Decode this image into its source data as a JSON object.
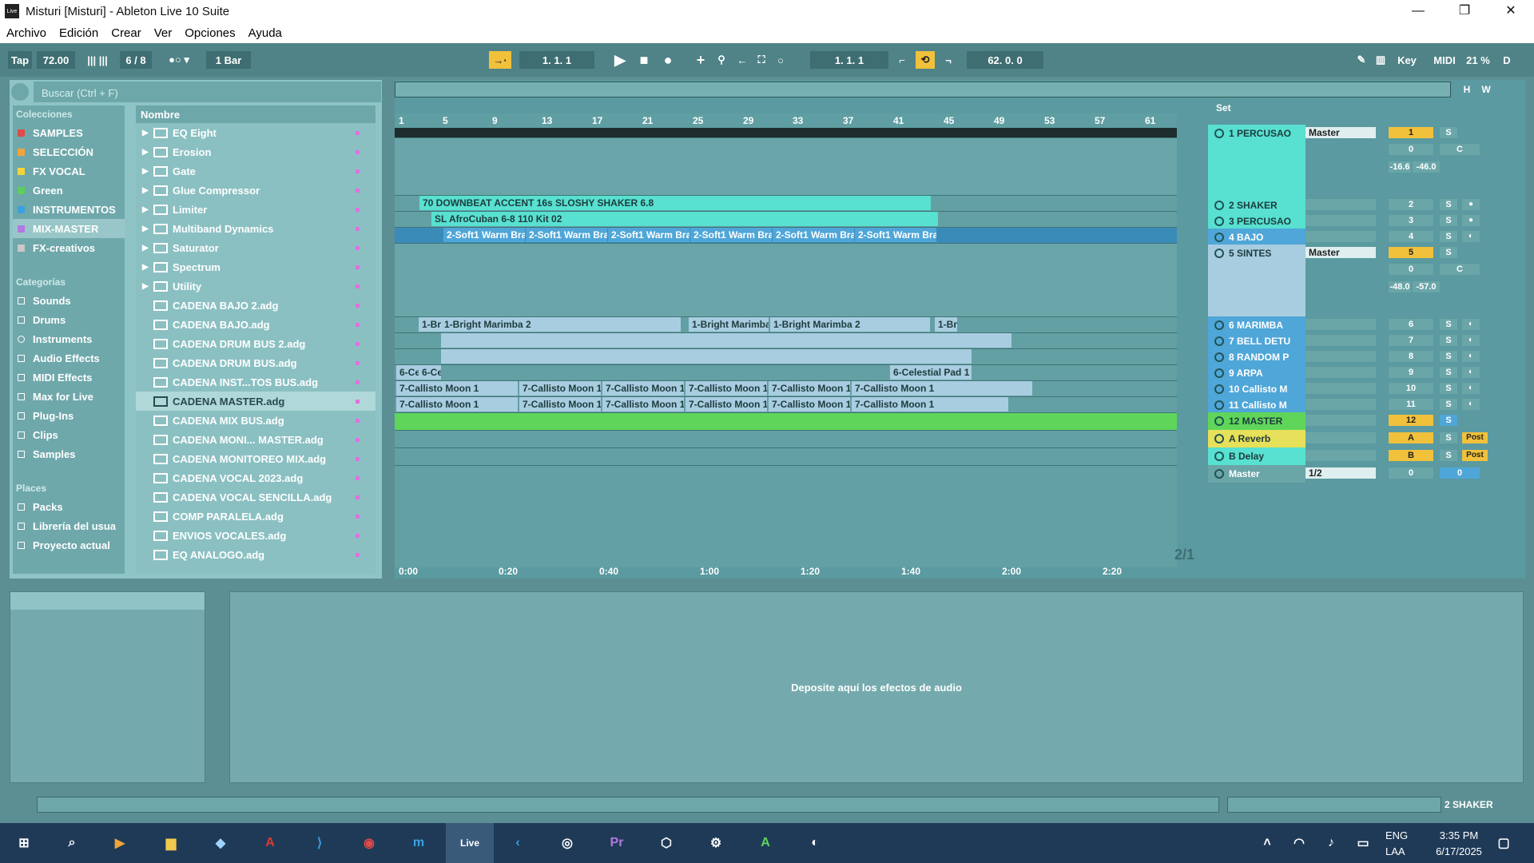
{
  "window": {
    "title": "Misturi  [Misturi] - Ableton Live 10 Suite",
    "app_icon": "Live"
  },
  "menu": [
    "Archivo",
    "Edición",
    "Crear",
    "Ver",
    "Opciones",
    "Ayuda"
  ],
  "control_bar": {
    "tap": "Tap",
    "tempo": "72.00",
    "signature": "6 / 8",
    "quantize": "1 Bar",
    "position": "1.   1.   1",
    "loop_start": "1.   1.   1",
    "loop_length": "62.   0.   0",
    "key": "Key",
    "midi": "MIDI",
    "cpu": "21 %",
    "d": "D"
  },
  "browser": {
    "search_placeholder": "Buscar (Ctrl + F)",
    "collections_header": "Colecciones",
    "collections": [
      {
        "label": "SAMPLES",
        "color": "#e04a4a"
      },
      {
        "label": "SELECCIÓN",
        "color": "#f0a43a"
      },
      {
        "label": "FX VOCAL",
        "color": "#f2d43a"
      },
      {
        "label": "Green",
        "color": "#5ccf5c"
      },
      {
        "label": "INSTRUMENTOS",
        "color": "#3aa0e0"
      },
      {
        "label": "MIX-MASTER",
        "color": "#b07ae0"
      },
      {
        "label": "FX-creativos",
        "color": "#c8c8c8"
      }
    ],
    "categories_header": "Categorías",
    "categories": [
      "Sounds",
      "Drums",
      "Instruments",
      "Audio Effects",
      "MIDI Effects",
      "Max for Live",
      "Plug-Ins",
      "Clips",
      "Samples"
    ],
    "places_header": "Places",
    "places": [
      "Packs",
      "Librería del usua",
      "Proyecto actual"
    ],
    "names_header": "Nombre",
    "folders": [
      "EQ Eight",
      "Erosion",
      "Gate",
      "Glue Compressor",
      "Limiter",
      "Multiband Dynamics",
      "Saturator",
      "Spectrum",
      "Utility"
    ],
    "files": [
      "CADENA BAJO 2.adg",
      "CADENA BAJO.adg",
      "CADENA DRUM BUS 2.adg",
      "CADENA DRUM BUS.adg",
      "CADENA INST...TOS BUS.adg",
      "CADENA MASTER.adg",
      "CADENA MIX BUS.adg",
      "CADENA MONI... MASTER.adg",
      "CADENA MONITOREO MIX.adg",
      "CADENA VOCAL 2023.adg",
      "CADENA VOCAL SENCILLA.adg",
      "COMP PARALELA.adg",
      "ENVIOS VOCALES.adg",
      "EQ ANALOGO.adg"
    ]
  },
  "ruler": [
    "1",
    "5",
    "9",
    "13",
    "17",
    "21",
    "25",
    "29",
    "33",
    "37",
    "41",
    "45",
    "49",
    "53",
    "57",
    "61"
  ],
  "time_ruler": [
    "0:00",
    "0:20",
    "0:40",
    "1:00",
    "1:20",
    "1:40",
    "2:00",
    "2:20"
  ],
  "clips": {
    "shaker": "70 DOWNBEAT ACCENT 16s SLOSHY SHAKER 6.8",
    "percu": "SL  AfroCuban  6-8  110  Kit  02",
    "brass": "2-Soft1 Warm Brass",
    "marimba": "1-Bright Marimba 2",
    "marimba_short": "1-Br",
    "celestial": "6-Celestial Pad 1",
    "celestial_short": "6-Ce",
    "callisto": "7-Callisto Moon 1"
  },
  "set_label": "Set",
  "page_indicator": "2/1",
  "tracks": [
    {
      "name": "1 PERCUSAO",
      "num": "1",
      "routing": "Master",
      "vol": "0",
      "pan": "C",
      "peak1": "-16.6",
      "peak2": "-46.0"
    },
    {
      "name": "2 SHAKER",
      "num": "2"
    },
    {
      "name": "3 PERCUSAO",
      "num": "3"
    },
    {
      "name": "4 BAJO",
      "num": "4"
    },
    {
      "name": "5 SINTES",
      "num": "5",
      "routing": "Master",
      "vol": "0",
      "pan": "C",
      "peak1": "-48.0",
      "peak2": "-57.0"
    },
    {
      "name": "6 MARIMBA",
      "num": "6"
    },
    {
      "name": "7 BELL DETU",
      "num": "7"
    },
    {
      "name": "8 RANDOM P",
      "num": "8"
    },
    {
      "name": "9 ARPA",
      "num": "9"
    },
    {
      "name": "10 Callisto M",
      "num": "10"
    },
    {
      "name": "11 Callisto M",
      "num": "11"
    },
    {
      "name": "12 MASTER",
      "num": "12"
    },
    {
      "name": "A Reverb",
      "num": "A",
      "post": "Post"
    },
    {
      "name": "B Delay",
      "num": "B",
      "post": "Post"
    },
    {
      "name": "Master",
      "num": "0",
      "routing": "1/2",
      "vol": "0"
    }
  ],
  "solo_label": "S",
  "detail": {
    "drop_text": "Deposite aquí los efectos de audio"
  },
  "status": {
    "selected_track": "2 SHAKER"
  },
  "taskbar": {
    "lang1": "ENG",
    "lang2": "LAA",
    "time": "3:35 PM",
    "date": "6/17/2025",
    "live_icon": "Live"
  },
  "colors": {
    "cyan_clip": "#58e0d0",
    "blue_clip": "#4fa6d8",
    "light_clip": "#a9cde0",
    "green_master": "#5fd65a",
    "yellow": "#f1c13c"
  }
}
